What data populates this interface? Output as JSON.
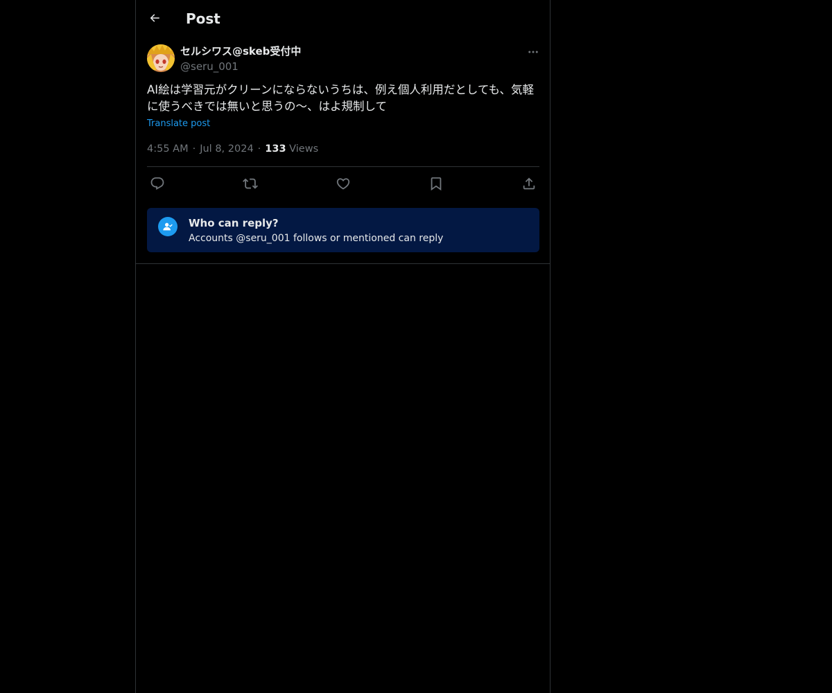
{
  "header": {
    "title": "Post"
  },
  "author": {
    "display_name": "セルシワス@skeb受付中",
    "handle": "@seru_001"
  },
  "post": {
    "text": "AI絵は学習元がクリーンにならないうちは、例え個人利用だとしても、気軽に使うべきでは無いと思うの〜、はよ規制して",
    "translate_label": "Translate post",
    "time": "4:55 AM",
    "date": "Jul 8, 2024",
    "views_count": "133",
    "views_label": "Views"
  },
  "reply_restriction": {
    "title": "Who can reply?",
    "subtitle": "Accounts @seru_001 follows or mentioned can reply"
  },
  "icons": {
    "back": "arrow-left-icon",
    "more": "ellipsis-icon",
    "reply": "reply-icon",
    "repost": "repost-icon",
    "like": "heart-icon",
    "bookmark": "bookmark-icon",
    "share": "share-icon",
    "who_can_reply": "person-check-icon"
  },
  "colors": {
    "accent": "#1d9bf0",
    "reply_box_bg": "#031843",
    "muted_text": "#71767b"
  }
}
